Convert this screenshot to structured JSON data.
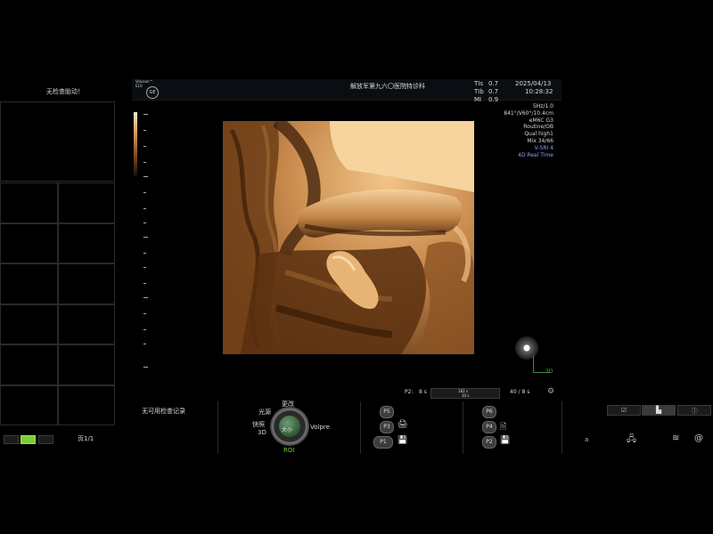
{
  "left_panel": {
    "no_fetal_heart": "无检查胎动！",
    "page_label": "页1/1"
  },
  "header": {
    "product_logo": "Voluson™ E10",
    "brand_logo": "GE",
    "institution": "解放军第九六〇医院特诊科",
    "tis_label": "TIs",
    "tis_value": "0.7",
    "tib_label": "TIb",
    "tib_value": "0.7",
    "mi_label": "MI",
    "mi_value": "0.9",
    "date": "2025/04/13",
    "time": "10:28:32"
  },
  "params": [
    {
      "text": "5Hz/1.0",
      "color": "#d8d8d8"
    },
    {
      "text": "841°/V60°/10.4cm",
      "color": "#d8d8d8"
    },
    {
      "text": "eM6C G3",
      "color": "#d8d8d8"
    },
    {
      "text": "Routine/OB",
      "color": "#d8d8d8"
    },
    {
      "text": "Qual high1",
      "color": "#d8d8d8"
    },
    {
      "text": "Mix 34/66",
      "color": "#d8d8d8"
    },
    {
      "text": "V-SRI 4",
      "color": "#8ea0ff"
    },
    {
      "text": "4D Real Time",
      "color": "#8ea0ff"
    }
  ],
  "cine": {
    "p2": "P2:",
    "eight_s": "8 s",
    "bar1": "182 s",
    "bar2": "30 s",
    "frames": "40 / 8 s"
  },
  "orientation": {
    "label": "3D"
  },
  "bottom": {
    "no_records": "无可用检查记录",
    "knob_top": "更改",
    "knob_upper_left": "光源",
    "knob_left_1": "快照",
    "knob_left_2": "3D",
    "knob_right": "Volpre",
    "knob_center": "大小",
    "knob_bottom": "ROI",
    "p_buttons_left": [
      "P5",
      "P3",
      "P1"
    ],
    "p_buttons_right": [
      "P6",
      "P4",
      "P2"
    ]
  },
  "right_tabs": [
    "images",
    "measure",
    "info"
  ],
  "right_icons": {
    "text_label": "a"
  },
  "colors": {
    "accent_green": "#7dcc3a",
    "volume_tint": "#d9a060",
    "param_blue": "#8ea0ff"
  }
}
